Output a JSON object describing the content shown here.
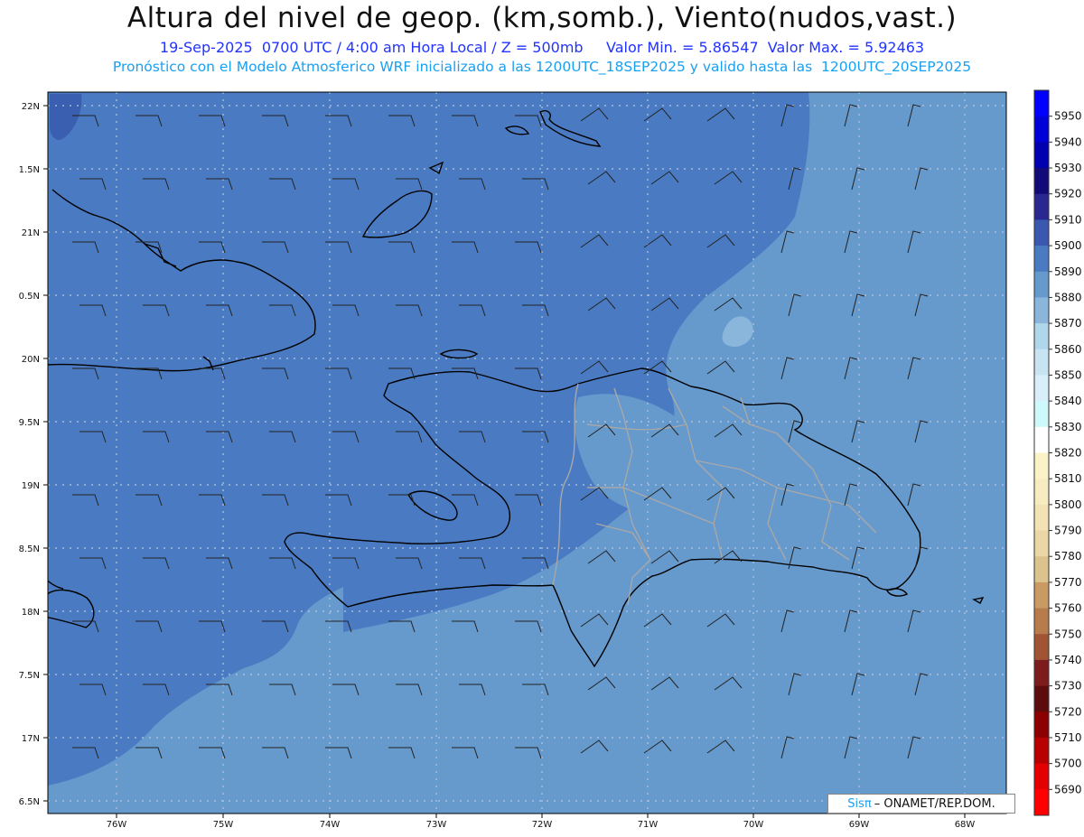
{
  "header": {
    "title": "Altura del nivel de geop. (km,somb.), Viento(nudos,vast.)",
    "subtitle_date": "19-Sep-2025  0700 UTC / 4:00 am Hora Local / Z = 500mb",
    "subtitle_range": "Valor Min. = 5.86547  Valor Max. = 5.92463",
    "subtitle_model": "Pronóstico con el Modelo Atmosferico WRF inicializado a las 1200UTC_18SEP2025 y valido hasta las  1200UTC_20SEP2025"
  },
  "credit": {
    "brand": "Sisπ",
    "text": "– ONAMET/REP.DOM."
  },
  "map": {
    "lon_labels": [
      "76W",
      "75W",
      "74W",
      "73W",
      "72W",
      "71W",
      "70W",
      "69W",
      "68W"
    ],
    "lat_labels": [
      "22N",
      "1.5N",
      "21N",
      "0.5N",
      "20N",
      "9.5N",
      "19N",
      "8.5N",
      "18N",
      "7.5N",
      "17N",
      "6.5N"
    ],
    "colors": {
      "field_dark": "#3a5fb0",
      "field_main": "#4a7bc2",
      "field_light": "#6699cc",
      "field_lighter": "#8ab6dc",
      "field_pale": "#b0d6ec",
      "coast": "#000000",
      "borders": "#a8a8a8"
    }
  },
  "colorbar": {
    "labels": [
      "5950",
      "5940",
      "5930",
      "5920",
      "5910",
      "5900",
      "5890",
      "5880",
      "5870",
      "5860",
      "5850",
      "5840",
      "5830",
      "5820",
      "5810",
      "5800",
      "5790",
      "5780",
      "5770",
      "5760",
      "5750",
      "5740",
      "5730",
      "5720",
      "5710",
      "5700",
      "5690"
    ],
    "colors": [
      "#0000ff",
      "#0000d8",
      "#0000b0",
      "#120a78",
      "#2a2890",
      "#3a58b0",
      "#4a7bc2",
      "#6699cc",
      "#8ab6dc",
      "#b0d6ec",
      "#c8e4f2",
      "#d8eef8",
      "#cef8fa",
      "#ffffff",
      "#fbf3c8",
      "#f7ecc0",
      "#f2e2b4",
      "#ebd6a6",
      "#dcc28c",
      "#c99a62",
      "#b87c4c",
      "#a05434",
      "#7c1c1c",
      "#5c0c0c",
      "#8c0000",
      "#b80000",
      "#e40000",
      "#ff0000"
    ]
  }
}
